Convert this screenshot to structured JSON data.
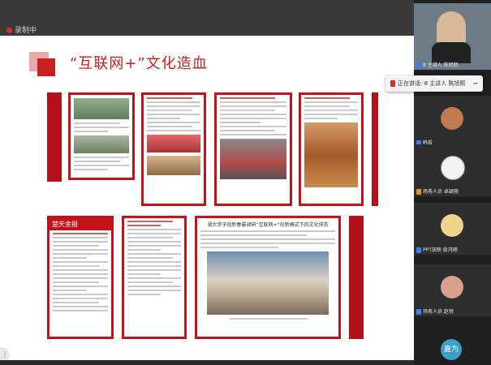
{
  "recording": {
    "label": "录制中"
  },
  "slide": {
    "title": "“互联网+”文化造血"
  },
  "speaking_banner": {
    "text": "正在讲话: 8 主讲人 陈旭熙"
  },
  "participants": [
    {
      "label": "8 主讲人 陈旭熙",
      "mic": "blue"
    },
    {
      "label": "韩投",
      "mic": "blue"
    },
    {
      "label": "场务人员 卓颖丽",
      "mic": "orange"
    },
    {
      "label": "PPT放映 俞鸿翔",
      "mic": "blue"
    },
    {
      "label": "场务人员 赵悦",
      "mic": "blue"
    }
  ],
  "bottom_user": {
    "initials": "嘉为"
  },
  "cards": {
    "c5_header": "楚天金报",
    "c7_header": "湖大学子创新春暮调研“互联网+”创新模式下的文化扶贫"
  },
  "colors": {
    "accent": "#c4121b",
    "title": "#c81f1f",
    "mic": "#3e7bfa"
  }
}
